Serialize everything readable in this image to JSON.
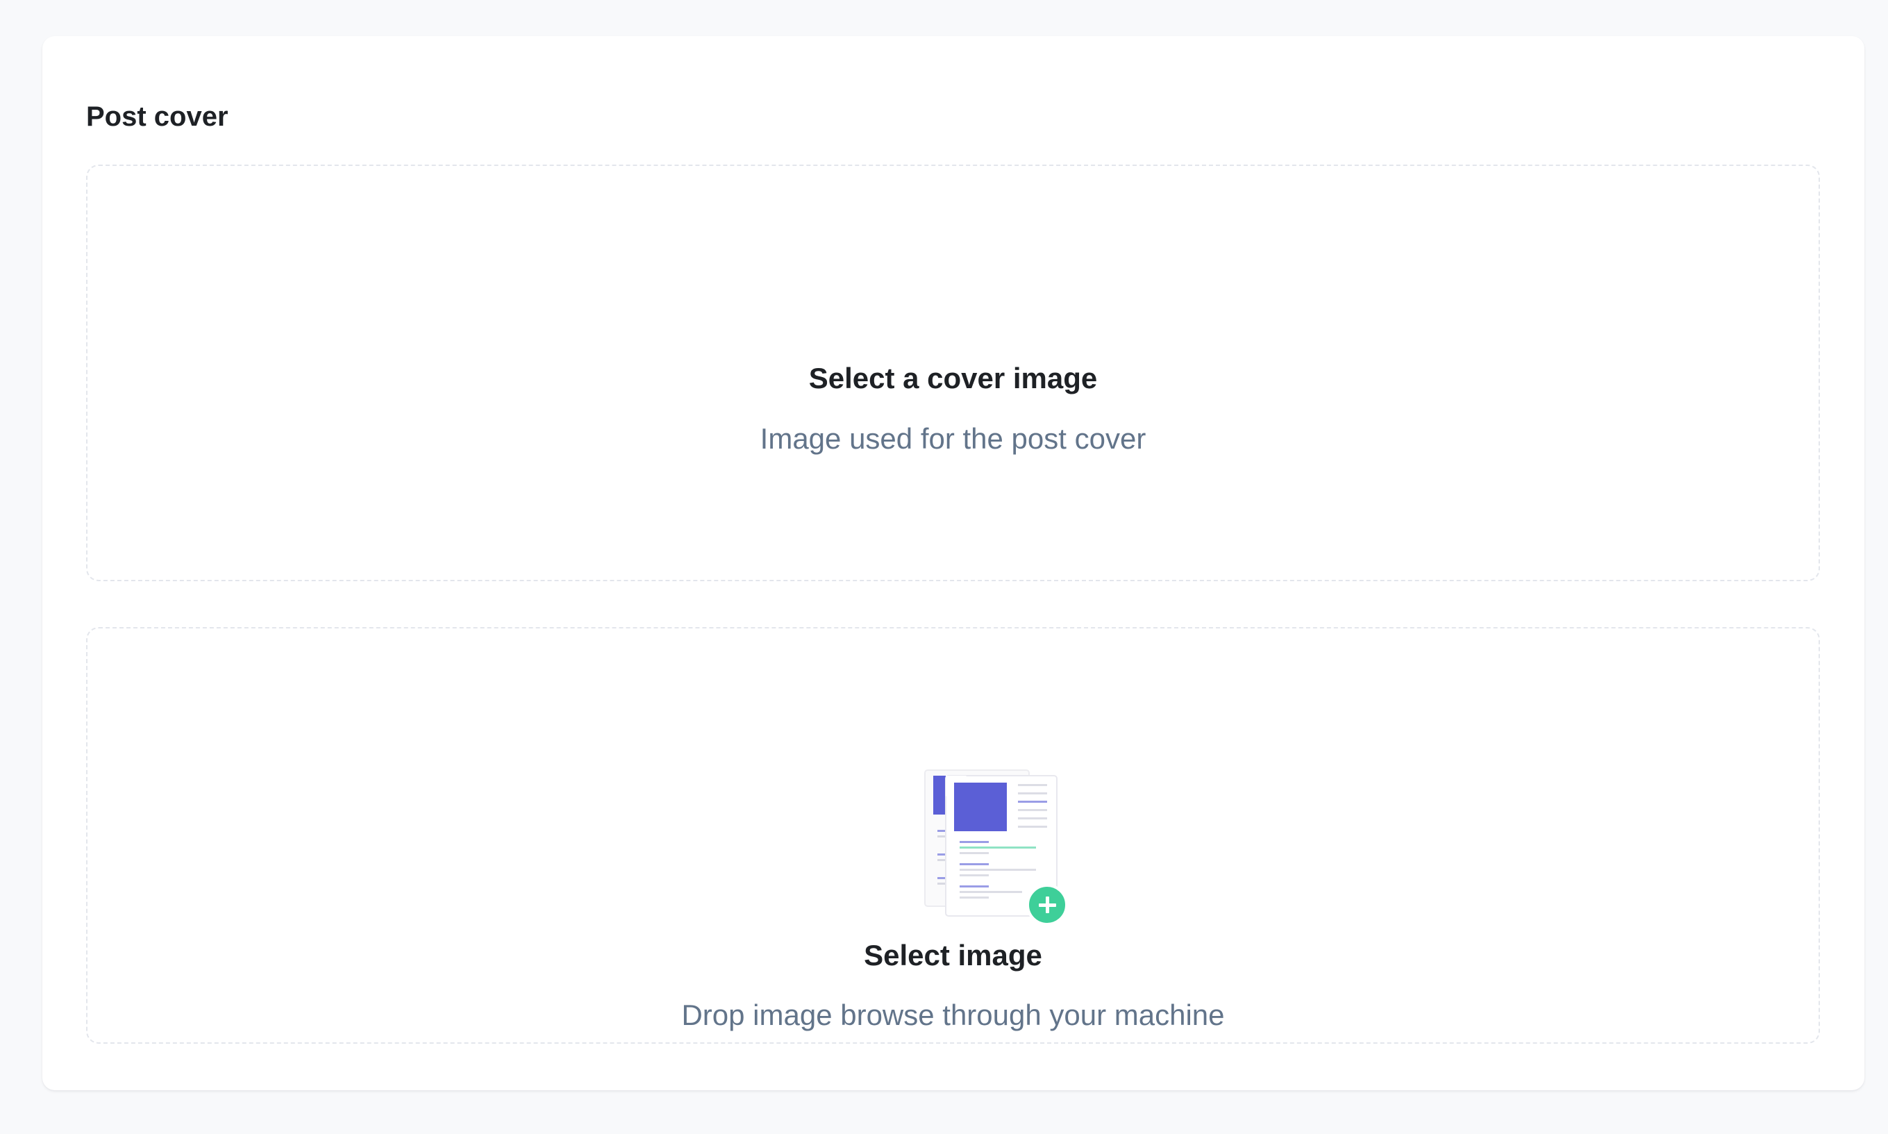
{
  "card": {
    "title": "Post cover"
  },
  "cover_dropzone": {
    "title": "Select a cover image",
    "subtitle": "Image used for the post cover"
  },
  "upload_dropzone": {
    "title": "Select image",
    "subtitle": "Drop image browse through your machine",
    "icon": "documents-add-icon"
  },
  "colors": {
    "accent": "#5b5fd6",
    "success": "#3ecf99",
    "title_text": "#1e2125",
    "muted_text": "#62748a",
    "dashed_border": "#e3e6ec",
    "page_background": "#f8f9fb"
  }
}
